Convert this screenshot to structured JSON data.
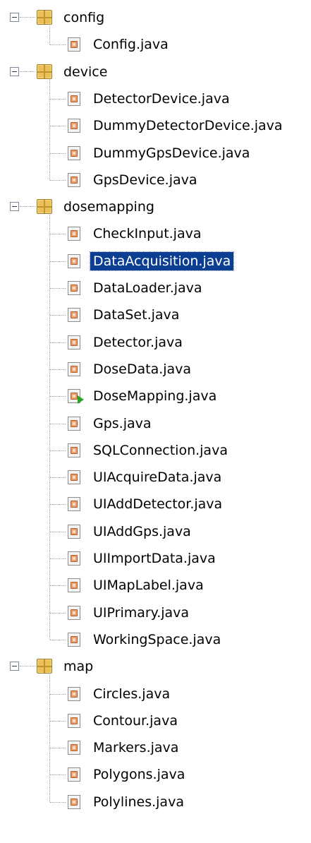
{
  "tree": [
    {
      "name": "config",
      "files": [
        "Config.java"
      ]
    },
    {
      "name": "device",
      "files": [
        "DetectorDevice.java",
        "DummyDetectorDevice.java",
        "DummyGpsDevice.java",
        "GpsDevice.java"
      ]
    },
    {
      "name": "dosemapping",
      "files": [
        "CheckInput.java",
        "DataAcquisition.java",
        "DataLoader.java",
        "DataSet.java",
        "Detector.java",
        "DoseData.java",
        "DoseMapping.java",
        "Gps.java",
        "SQLConnection.java",
        "UIAcquireData.java",
        "UIAddDetector.java",
        "UIAddGps.java",
        "UIImportData.java",
        "UIMapLabel.java",
        "UIPrimary.java",
        "WorkingSpace.java"
      ]
    },
    {
      "name": "map",
      "files": [
        "Circles.java",
        "Contour.java",
        "Markers.java",
        "Polygons.java",
        "Polylines.java"
      ]
    }
  ],
  "selected_file": "DataAcquisition.java",
  "runnable_file": "DoseMapping.java",
  "icons": {
    "package": "package-icon",
    "java": "java-file-icon",
    "expander": "collapse-minus-icon"
  },
  "colors": {
    "selection_bg": "#0b3d91",
    "selection_text": "#ffffff"
  }
}
